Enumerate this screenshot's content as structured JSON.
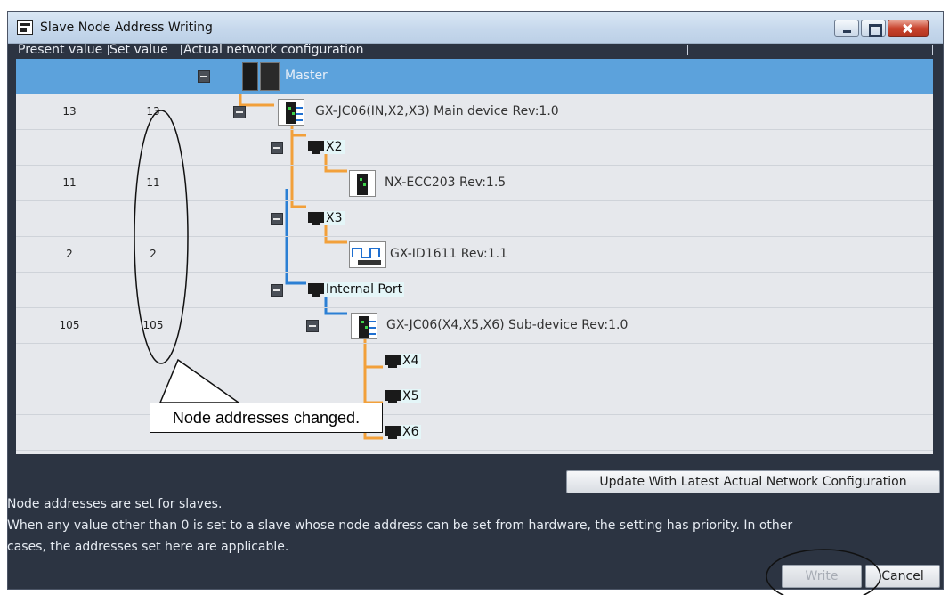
{
  "window": {
    "title": "Slave Node Address Writing"
  },
  "columns": {
    "present": "Present value",
    "set": "Set value",
    "config": "Actual network configuration"
  },
  "rows": [
    {
      "present": "",
      "set": "",
      "label": "Master",
      "kind": "master"
    },
    {
      "present": "13",
      "set": "13",
      "label": "GX-JC06(IN,X2,X3) Main device Rev:1.0",
      "kind": "device"
    },
    {
      "present": "",
      "set": "",
      "label": "X2",
      "kind": "port"
    },
    {
      "present": "11",
      "set": "11",
      "label": "NX-ECC203 Rev:1.5",
      "kind": "device"
    },
    {
      "present": "",
      "set": "",
      "label": "X3",
      "kind": "port"
    },
    {
      "present": "2",
      "set": "2",
      "label": "GX-ID1611 Rev:1.1",
      "kind": "device"
    },
    {
      "present": "",
      "set": "",
      "label": "Internal Port",
      "kind": "port"
    },
    {
      "present": "105",
      "set": "105",
      "label": "GX-JC06(X4,X5,X6) Sub-device Rev:1.0",
      "kind": "device"
    },
    {
      "present": "",
      "set": "",
      "label": "X4",
      "kind": "port"
    },
    {
      "present": "",
      "set": "",
      "label": "X5",
      "kind": "port"
    },
    {
      "present": "",
      "set": "",
      "label": "X6",
      "kind": "port"
    }
  ],
  "buttons": {
    "update": "Update With Latest Actual Network Configuration",
    "write": "Write",
    "cancel": "Cancel"
  },
  "info": {
    "line1": "Node addresses are set for slaves.",
    "line2": "When any value other than 0 is set to a slave whose node address can be set from hardware, the setting has priority. In other",
    "line3": "cases, the addresses set here are applicable."
  },
  "callout": {
    "text": "Node addresses changed."
  },
  "colors": {
    "selection": "#5ca2dc",
    "line_orange": "#f2a03a",
    "line_blue": "#2b7fd4",
    "dialog_bg": "#2c3442"
  }
}
